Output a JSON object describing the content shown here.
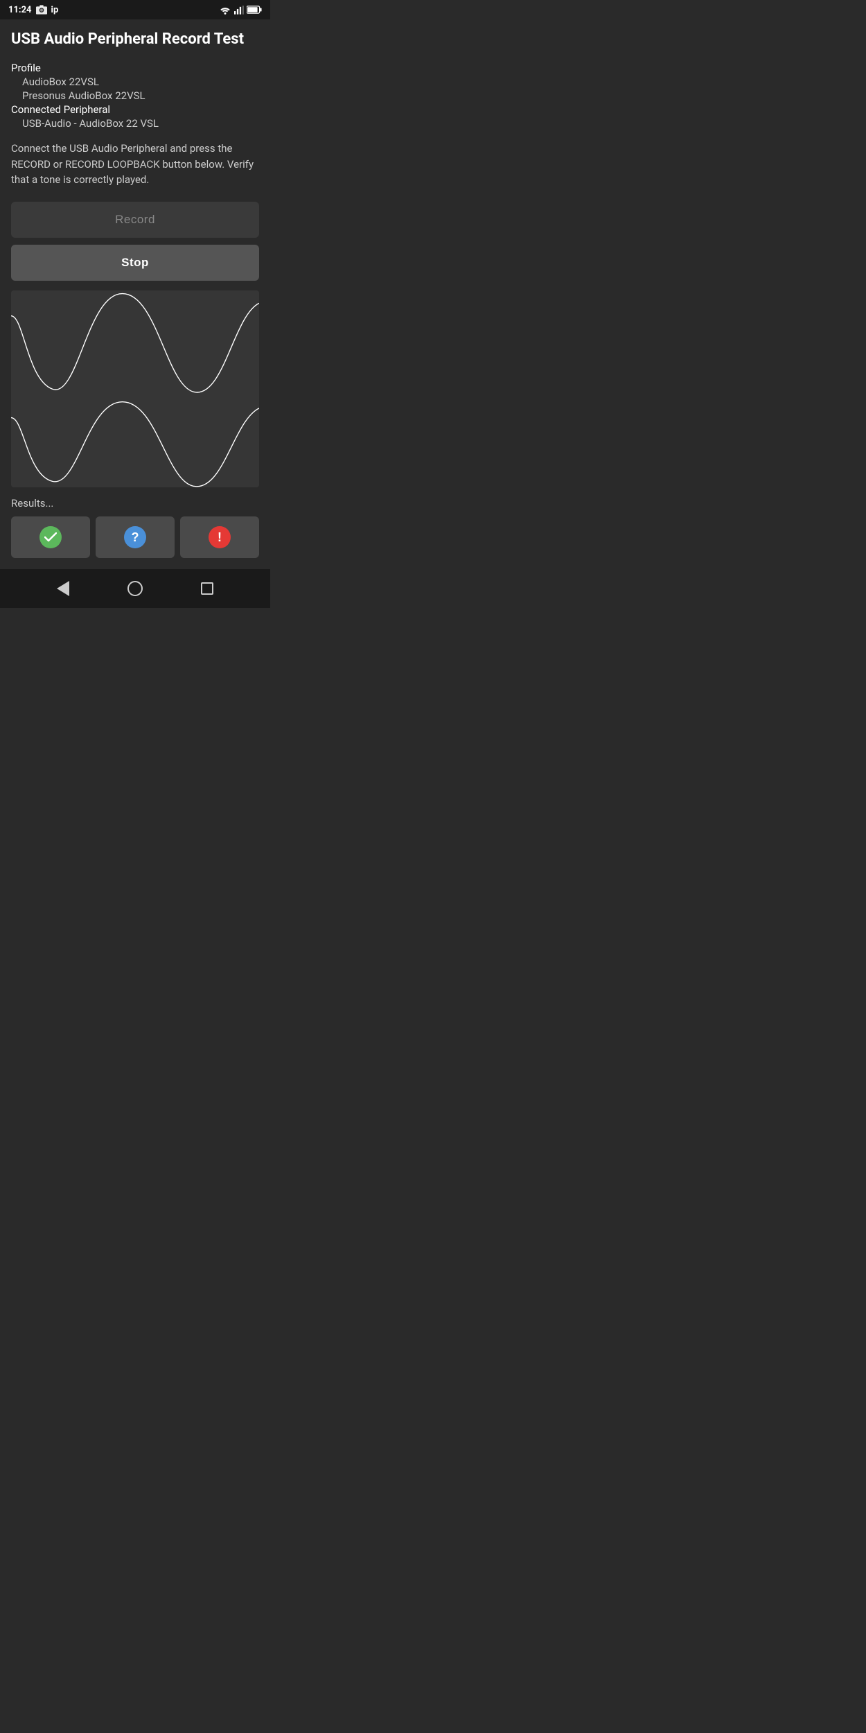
{
  "statusBar": {
    "time": "11:24",
    "icons": [
      "photo",
      "ip"
    ],
    "rightIcons": [
      "wifi",
      "signal",
      "battery"
    ]
  },
  "page": {
    "title": "USB Audio Peripheral Record Test",
    "profile": {
      "label": "Profile",
      "line1": "AudioBox 22VSL",
      "line2": "Presonus AudioBox 22VSL"
    },
    "connectedPeripheral": {
      "label": "Connected Peripheral",
      "value": "USB-Audio - AudioBox 22 VSL"
    },
    "description": "Connect the USB Audio Peripheral and press the RECORD or RECORD LOOPBACK button below. Verify that a tone is correctly played.",
    "recordButton": "Record",
    "stopButton": "Stop",
    "resultsLabel": "Results...",
    "resultButtons": [
      {
        "type": "check",
        "label": "pass"
      },
      {
        "type": "question",
        "label": "unknown"
      },
      {
        "type": "exclamation",
        "label": "fail"
      }
    ]
  },
  "navBar": {
    "back": "back",
    "home": "home",
    "recent": "recent"
  }
}
